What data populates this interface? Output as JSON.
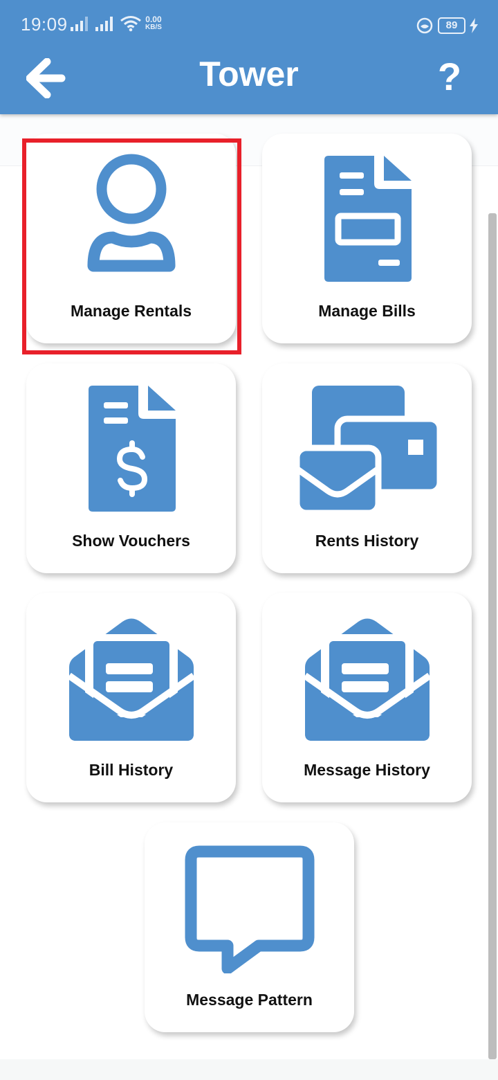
{
  "status_bar": {
    "time": "19:09",
    "net_speed_value": "0.00",
    "net_speed_unit": "KB/S",
    "battery": "89"
  },
  "header": {
    "title": "Tower",
    "back_icon": "arrow-left-icon",
    "help_text": "?"
  },
  "colors": {
    "primary": "#4f8fcd",
    "highlight": "#e8202a"
  },
  "menu": [
    {
      "label": "Manage Rentals",
      "icon": "user-icon"
    },
    {
      "label": "Manage Bills",
      "icon": "document-icon"
    },
    {
      "label": "Show Vouchers",
      "icon": "voucher-icon"
    },
    {
      "label": "Rents History",
      "icon": "mail-card-icon"
    },
    {
      "label": "Bill History",
      "icon": "open-envelope-icon"
    },
    {
      "label": "Message History",
      "icon": "open-envelope-icon"
    },
    {
      "label": "Message Pattern",
      "icon": "chat-bubble-icon"
    }
  ]
}
